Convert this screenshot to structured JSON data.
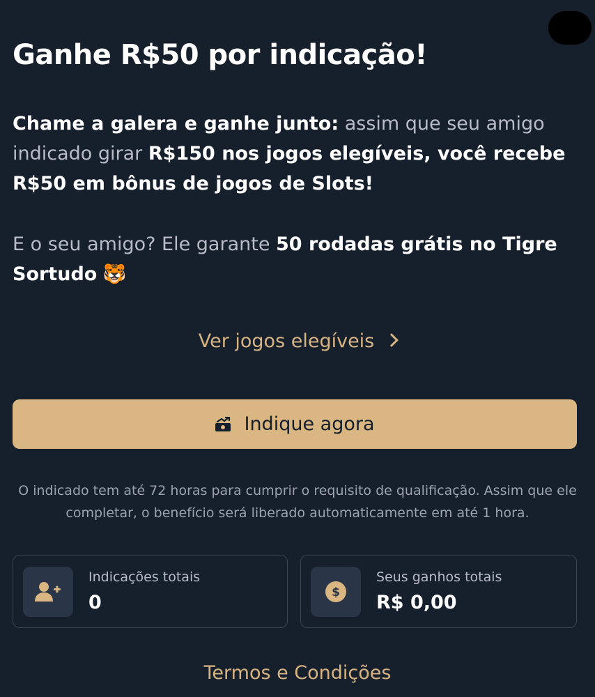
{
  "header": {
    "title": "Ganhe R$50 por indicação!"
  },
  "intro": {
    "lead_bold": "Chame a galera e ganhe junto:",
    "text_1": " assim que seu amigo indicado girar ",
    "bold_1": "R$150 nos jogos elegíveis, você recebe R$50 em bônus de jogos de Slots!"
  },
  "friend": {
    "text": "E o seu amigo? Ele garante ",
    "bold": "50 rodadas grátis no Tigre Sortudo",
    "emoji": "🐯"
  },
  "links": {
    "see_games": "Ver jogos elegíveis"
  },
  "cta": {
    "label": "Indique agora",
    "icon": "money-send-icon"
  },
  "note": "O indicado tem até 72 horas para cumprir o requisito de qualificação. Assim que ele completar, o benefício será liberado automaticamente em até 1 hora.",
  "stats": [
    {
      "label": "Indicações totais",
      "value": "0",
      "icon": "add-user-icon"
    },
    {
      "label": "Seus ganhos totais",
      "value": "R$ 0,00",
      "icon": "dollar-coin-icon"
    }
  ],
  "footer": {
    "terms": "Termos e Condições"
  },
  "colors": {
    "background": "#161f2c",
    "accent": "#d9b682",
    "card_icon_bg": "#2a3647"
  }
}
